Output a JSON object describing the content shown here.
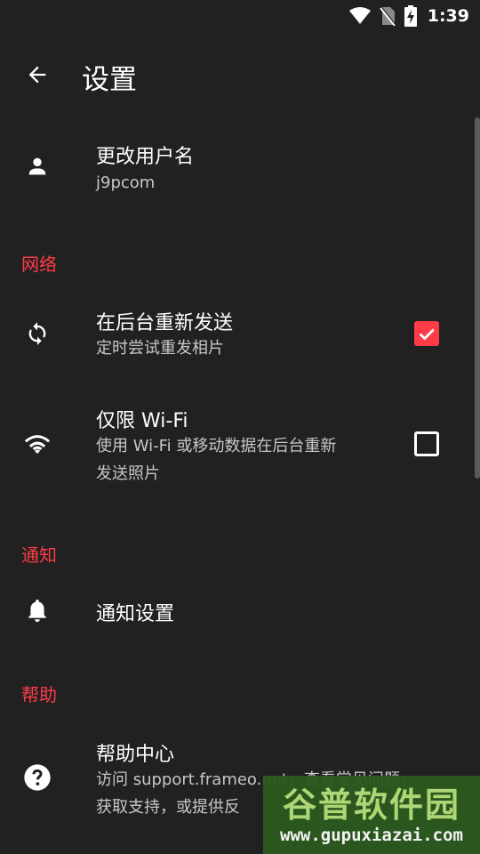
{
  "status_bar": {
    "time": "1:39",
    "icons": [
      "wifi-icon",
      "no-sim-icon",
      "battery-charging-icon"
    ]
  },
  "app_bar": {
    "title": "设置",
    "back_icon": "arrow-back-icon"
  },
  "account": {
    "primary": "更改用户名",
    "secondary": "j9pcom",
    "icon": "person-icon"
  },
  "sections": {
    "network": "网络",
    "notifications": "通知",
    "help": "帮助"
  },
  "resend_background": {
    "primary": "在后台重新发送",
    "secondary": "定时尝试重发相片",
    "icon": "sync-icon",
    "checked": true
  },
  "wifi_only": {
    "primary": "仅限 Wi-Fi",
    "secondary_line1": "使用 Wi-Fi 或移动数据在后台重新",
    "secondary_line2": "发送照片",
    "icon": "wifi-icon",
    "checked": false
  },
  "notification_settings": {
    "primary": "通知设置",
    "icon": "bell-icon"
  },
  "help_center": {
    "primary": "帮助中心",
    "secondary_line1": "访问 support.frameo.net，查看常见问题，",
    "secondary_line2": "获取支持，或提供反",
    "icon": "help-circle-icon"
  },
  "watermark": {
    "logo": "谷普软件园",
    "url": "www.gupuxiazai.com"
  },
  "colors": {
    "background": "#212121",
    "accent": "#ff3b47",
    "secondary_text": "#c7c7c7"
  }
}
